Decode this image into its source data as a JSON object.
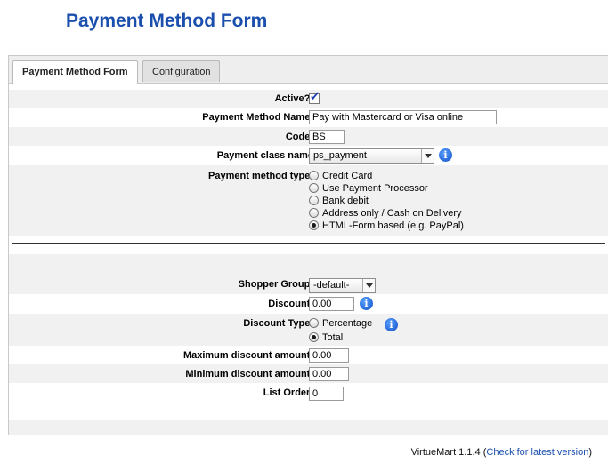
{
  "page": {
    "title": "Payment Method Form"
  },
  "tabs": [
    {
      "label": "Payment Method Form",
      "active": true
    },
    {
      "label": "Configuration",
      "active": false
    }
  ],
  "form": {
    "active": {
      "label": "Active?:",
      "checked": true
    },
    "name": {
      "label": "Payment Method Name:",
      "value": "Pay with Mastercard or Visa online"
    },
    "code": {
      "label": "Code:",
      "value": "BS"
    },
    "payment_class": {
      "label": "Payment class name",
      "selected": "ps_payment",
      "info_icon": "info-icon"
    },
    "method_type": {
      "label": "Payment method type:",
      "options": [
        "Credit Card",
        "Use Payment Processor",
        "Bank debit",
        "Address only / Cash on Delivery",
        "HTML-Form based (e.g. PayPal)"
      ],
      "selected_index": 4
    },
    "shopper_group": {
      "label": "Shopper Group:",
      "selected": "-default-"
    },
    "discount": {
      "label": "Discount:",
      "value": "0.00",
      "info_icon": "info-icon"
    },
    "discount_type": {
      "label": "Discount Type:",
      "options": [
        "Percentage",
        "Total"
      ],
      "selected_index": 1,
      "info_icon": "info-icon"
    },
    "max_discount": {
      "label": "Maximum discount amount:",
      "value": "0.00"
    },
    "min_discount": {
      "label": "Minimum discount amount:",
      "value": "0.00"
    },
    "list_order": {
      "label": "List Order:",
      "value": "0"
    }
  },
  "footer": {
    "product": "VirtueMart 1.1.4",
    "link_text": "Check for latest version"
  },
  "colors": {
    "title": "#1b4fae",
    "alt_row": "#f1f1f1",
    "tab_bar": "#eeeeee"
  }
}
